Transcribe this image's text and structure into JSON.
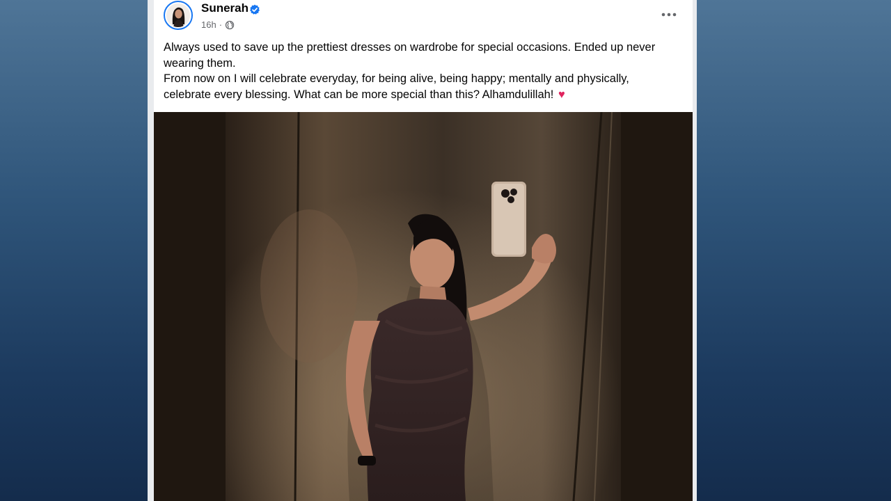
{
  "post": {
    "author": "Sunerah",
    "verified": true,
    "time": "16h",
    "separator": "·",
    "privacy_icon": "globe-icon",
    "caption_lines": [
      "Always used to save up the prettiest dresses on wardrobe for special occasions. Ended up never wearing them.",
      "From now on I will celebrate everyday, for being alive, being happy; mentally and physically, celebrate every blessing. What can be more special than this? Alhamdulillah!"
    ],
    "caption_emoji": "♥",
    "more_icon": "more-options-icon"
  },
  "colors": {
    "verified_blue": "#1877f2",
    "heart_red": "#e0245e",
    "photo_letterbox": "#1f1710"
  }
}
